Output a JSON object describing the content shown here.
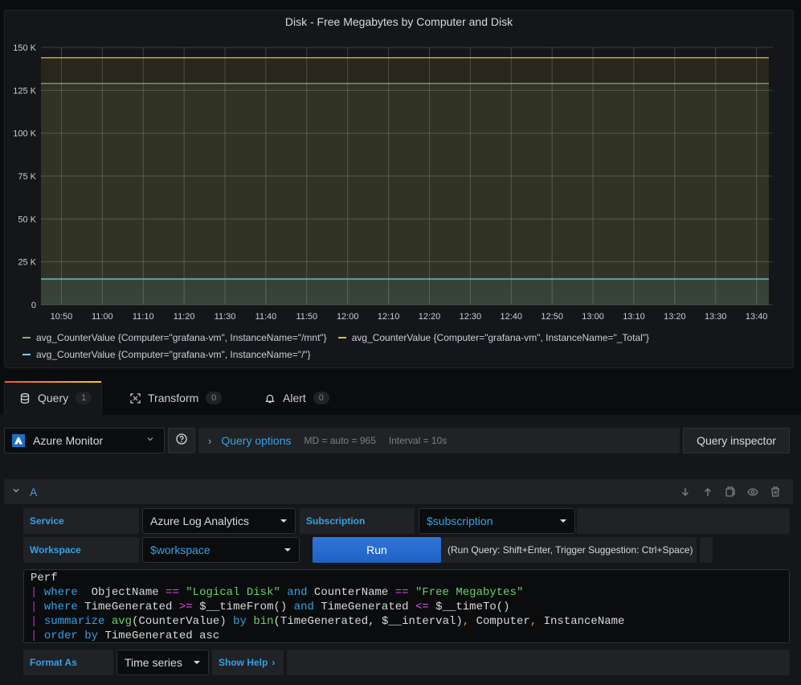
{
  "panel": {
    "title": "Disk - Free Megabytes by Computer and Disk"
  },
  "chart_data": {
    "type": "area",
    "title": "Disk - Free Megabytes by Computer and Disk",
    "xlabel": "",
    "ylabel": "",
    "x_ticks": [
      "10:50",
      "11:00",
      "11:10",
      "11:20",
      "11:30",
      "11:40",
      "11:50",
      "12:00",
      "12:10",
      "12:20",
      "12:30",
      "12:40",
      "12:50",
      "13:00",
      "13:10",
      "13:20",
      "13:30",
      "13:40"
    ],
    "x_range": [
      "10:45",
      "13:44"
    ],
    "y_ticks": [
      "0",
      "25 K",
      "50 K",
      "75 K",
      "100 K",
      "125 K",
      "150 K"
    ],
    "ylim": [
      0,
      150000
    ],
    "grid": true,
    "legend_position": "bottom",
    "series": [
      {
        "name": "avg_CounterValue {Computer=\"grafana-vm\", InstanceName=\"/mnt\"}",
        "color": "#7eb26d",
        "values": [
          129000,
          129000
        ]
      },
      {
        "name": "avg_CounterValue {Computer=\"grafana-vm\", InstanceName=\"_Total\"}",
        "color": "#eab839",
        "values": [
          144000,
          144000
        ]
      },
      {
        "name": "avg_CounterValue {Computer=\"grafana-vm\", InstanceName=\"/\"}",
        "color": "#6ed0e0",
        "values": [
          15000,
          15000
        ]
      }
    ]
  },
  "tabs": [
    {
      "label": "Query",
      "count": "1",
      "icon": "database-icon"
    },
    {
      "label": "Transform",
      "count": "0",
      "icon": "transform-icon"
    },
    {
      "label": "Alert",
      "count": "0",
      "icon": "bell-icon"
    }
  ],
  "datasource": {
    "name": "Azure Monitor"
  },
  "query_options": {
    "label": "Query options",
    "md": "MD = auto = 965",
    "interval": "Interval = 10s"
  },
  "query_inspector": "Query inspector",
  "query": {
    "ref_id": "A",
    "service_label": "Service",
    "service_value": "Azure Log Analytics",
    "subscription_label": "Subscription",
    "subscription_value": "$subscription",
    "workspace_label": "Workspace",
    "workspace_value": "$workspace",
    "run_label": "Run",
    "hint": "(Run Query: Shift+Enter, Trigger Suggestion: Ctrl+Space)",
    "format_label": "Format As",
    "format_value": "Time series",
    "show_help": "Show Help",
    "code": {
      "l1": "Perf",
      "l2": {
        "kw": "where",
        "a": "  ObjectName ",
        "op": "==",
        "s1": "\"Logical Disk\"",
        "and": "and",
        "b": " CounterName ",
        "s2": "\"Free Megabytes\""
      },
      "l3": {
        "kw": "where",
        "a": " TimeGenerated ",
        "op1": ">=",
        "b": " $__timeFrom() ",
        "and": "and",
        "c": " TimeGenerated ",
        "op2": "<=",
        "d": " $__timeTo()"
      },
      "l4": {
        "kw": "summarize",
        "fn1": "avg",
        "a": "(CounterValue) ",
        "by": "by",
        "fn2": "bin",
        "b": "(TimeGenerated, $__interval)",
        "c": " Computer",
        "d": " InstanceName"
      },
      "l5": {
        "kw": "order",
        "by": "by",
        "a": " TimeGenerated asc"
      }
    }
  }
}
